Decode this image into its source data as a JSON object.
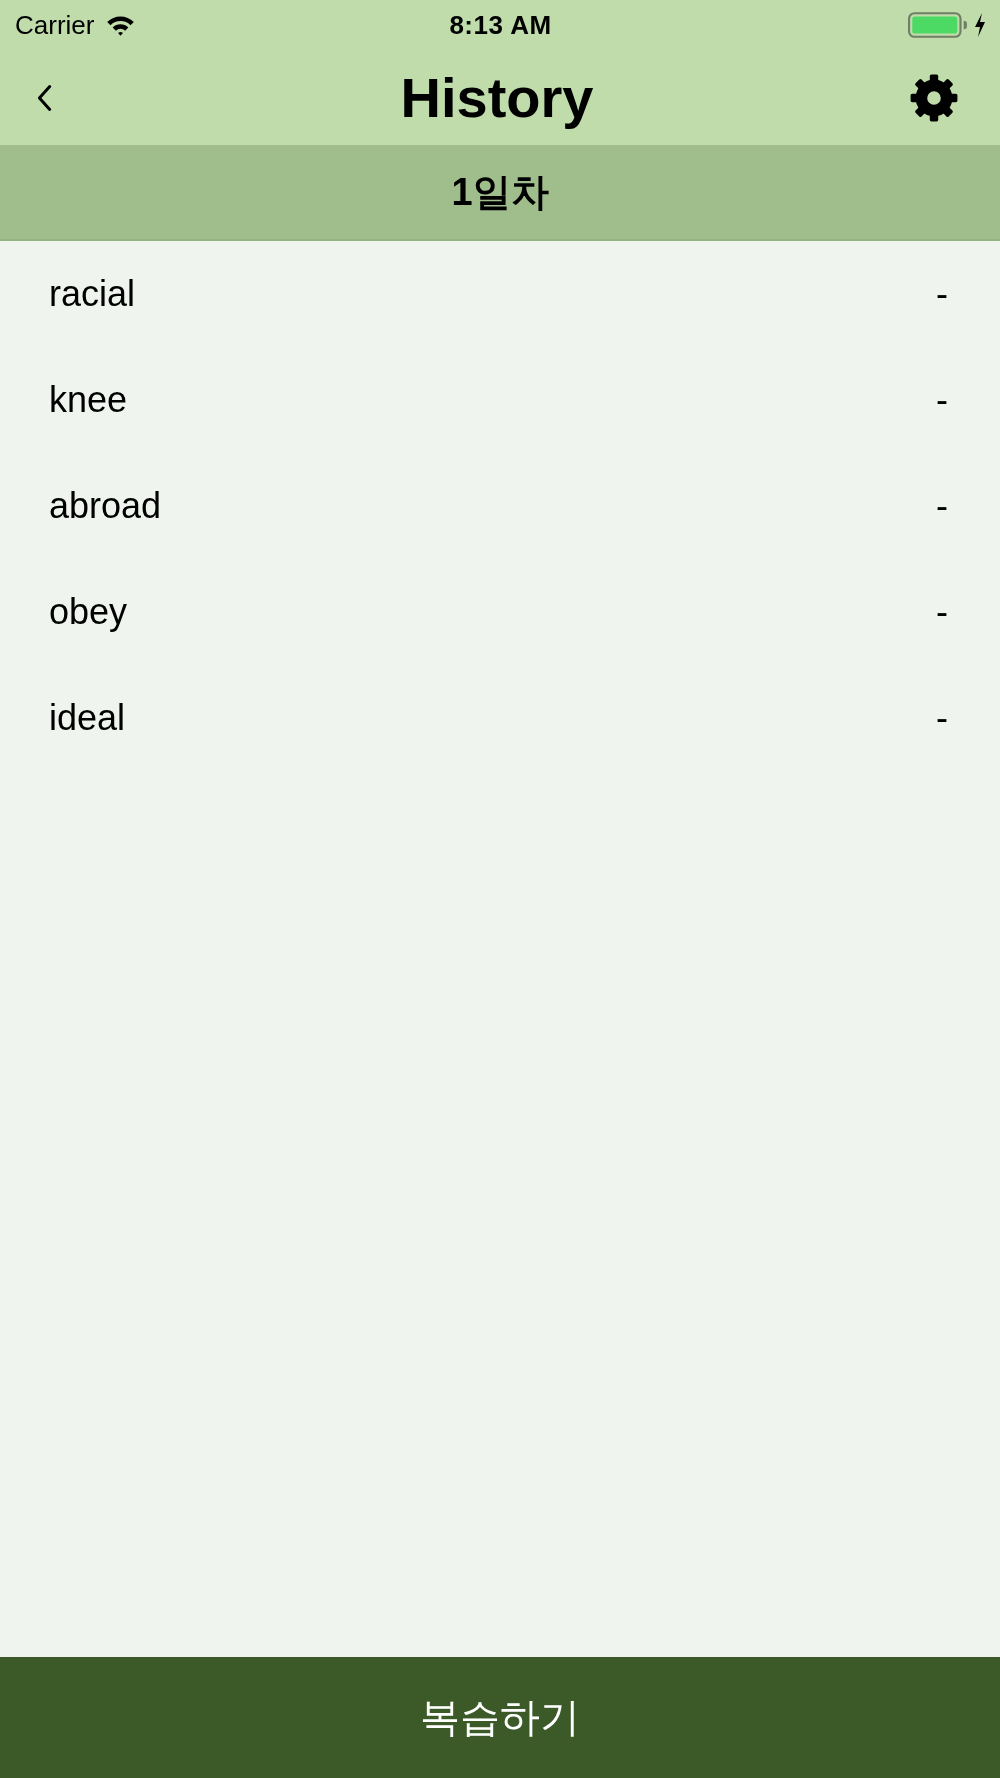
{
  "status_bar": {
    "carrier": "Carrier",
    "time": "8:13 AM"
  },
  "nav_bar": {
    "title": "History"
  },
  "section": {
    "title": "1일차"
  },
  "rows": [
    {
      "word": "racial",
      "result": "-"
    },
    {
      "word": "knee",
      "result": "-"
    },
    {
      "word": "abroad",
      "result": "-"
    },
    {
      "word": "obey",
      "result": "-"
    },
    {
      "word": "ideal",
      "result": "-"
    }
  ],
  "bottom_button": {
    "label": "복습하기"
  }
}
